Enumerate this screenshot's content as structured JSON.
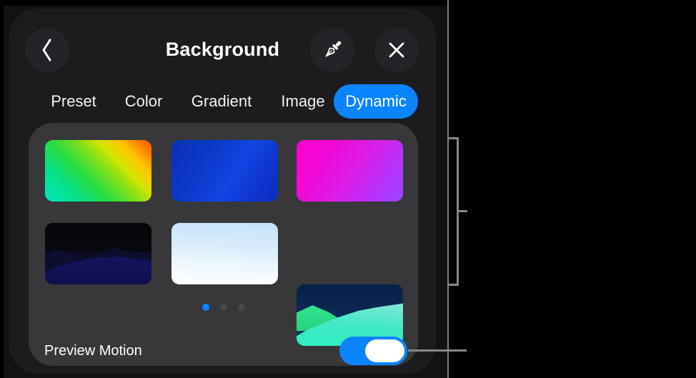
{
  "panel": {
    "title": "Background",
    "header": {
      "back_icon": "chevron-left",
      "eyedropper_icon": "eyedropper",
      "close_icon": "close"
    },
    "tabs": [
      {
        "label": "Preset",
        "selected": false
      },
      {
        "label": "Color",
        "selected": false
      },
      {
        "label": "Gradient",
        "selected": false
      },
      {
        "label": "Image",
        "selected": false
      },
      {
        "label": "Dynamic",
        "selected": true
      }
    ],
    "thumbnails": [
      {
        "name": "rainbow-diagonal-gradient",
        "colors": [
          "#00e8c2",
          "#2add3f",
          "#ffc400",
          "#ff4f00"
        ]
      },
      {
        "name": "blue-gradient",
        "colors": [
          "#0a31b2",
          "#1146e4"
        ]
      },
      {
        "name": "magenta-purple-gradient",
        "colors": [
          "#ff00cc",
          "#9c45ff"
        ]
      },
      {
        "name": "dark-blue-mountains",
        "colors": [
          "#060609",
          "#17177c"
        ]
      },
      {
        "name": "light-sky",
        "colors": [
          "#c6e2f8",
          "#ffffff"
        ]
      },
      {
        "name": "teal-mountains",
        "colors": [
          "#0a2148",
          "#3cf09a",
          "#3fe9c5"
        ]
      }
    ],
    "pager": {
      "dot_count": 3,
      "active_index": 0
    },
    "preview_motion": {
      "label": "Preview Motion",
      "enabled": true
    }
  },
  "colors": {
    "accent": "#0a84ff",
    "panel_bg": "#1c1c1e",
    "card_bg": "#38383b",
    "callout_gray": "#87878a"
  }
}
